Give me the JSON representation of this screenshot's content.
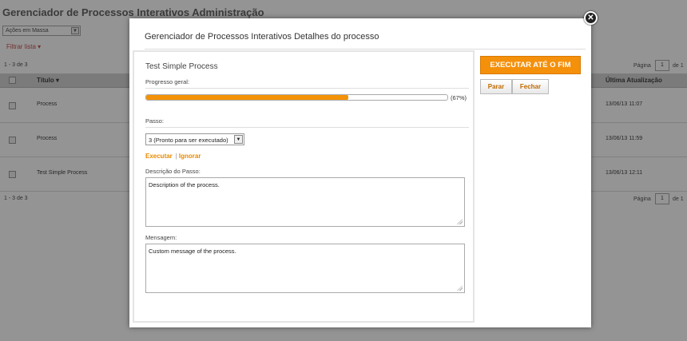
{
  "background": {
    "title": "Gerenciador de Processos Interativos Administração",
    "bulk_actions": "Ações em Massa",
    "filter": "Filtrar lista",
    "count": "1 - 3 de 3",
    "page_label": "Página",
    "page_value": "1",
    "page_of": "de 1",
    "columns": {
      "title": "Título",
      "last_update": "Última Atualização"
    },
    "rows": [
      {
        "name": "Process",
        "date": "13/06/13 11:07"
      },
      {
        "name": "Process",
        "date": "13/06/13 11:59"
      },
      {
        "name": "Test Simple Process",
        "date": "13/06/13 12:11"
      }
    ]
  },
  "modal": {
    "title": "Gerenciador de Processos Interativos Detalhes do processo",
    "close_icon": "close-icon",
    "process_name": "Test Simple Process",
    "progress_label": "Progresso geral:",
    "progress": 0.67,
    "progress_text": "(67%)",
    "step_label": "Passo:",
    "step_value": "3 (Pronto para ser executado)",
    "execute_link": "Executar",
    "ignore_link": "Ignorar",
    "description_label": "Descrição do Passo:",
    "description_value": "Description of the process.",
    "message_label": "Mensagem:",
    "message_value": "Custom message of the process.",
    "run_to_end": "EXECUTAR ATÉ O FIM",
    "stop": "Parar",
    "close": "Fechar",
    "accent_color": "#f5900b"
  }
}
